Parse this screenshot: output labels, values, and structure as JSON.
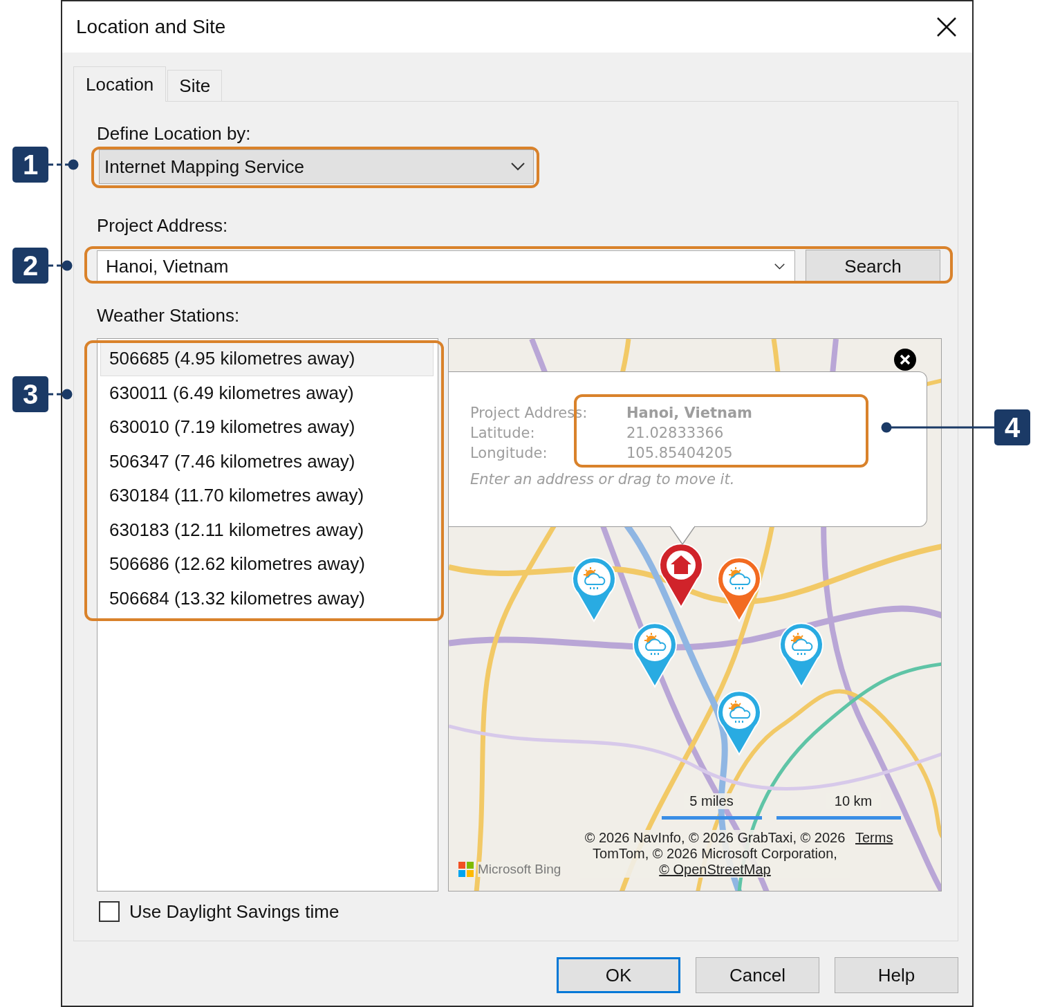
{
  "window": {
    "title": "Location and Site"
  },
  "tabs": [
    {
      "label": "Location",
      "selected": true
    },
    {
      "label": "Site",
      "selected": false
    }
  ],
  "define_location": {
    "label": "Define Location by:",
    "value": "Internet Mapping Service"
  },
  "project_address": {
    "label": "Project Address:",
    "value": "Hanoi, Vietnam",
    "button": "Search"
  },
  "weather_stations": {
    "label": "Weather Stations:",
    "items": [
      {
        "text": "506685 (4.95 kilometres away)",
        "selected": true
      },
      {
        "text": "630011 (6.49 kilometres away)",
        "selected": false
      },
      {
        "text": "630010 (7.19 kilometres away)",
        "selected": false
      },
      {
        "text": "506347 (7.46 kilometres away)",
        "selected": false
      },
      {
        "text": "630184 (11.70 kilometres away)",
        "selected": false
      },
      {
        "text": "630183 (12.11 kilometres away)",
        "selected": false
      },
      {
        "text": "506686 (12.62 kilometres away)",
        "selected": false
      },
      {
        "text": "506684 (13.32 kilometres away)",
        "selected": false
      }
    ]
  },
  "map": {
    "kind": "picture",
    "pins": [
      {
        "kind": "home",
        "color": "#d0232a"
      },
      {
        "kind": "weather",
        "color": "#29abe2"
      },
      {
        "kind": "weather",
        "color": "#f26b21"
      },
      {
        "kind": "weather",
        "color": "#29abe2"
      },
      {
        "kind": "weather",
        "color": "#29abe2"
      },
      {
        "kind": "weather",
        "color": "#29abe2"
      }
    ],
    "popup": {
      "rows": [
        {
          "label": "Project Address:",
          "value": "Hanoi, Vietnam",
          "bold": true
        },
        {
          "label": "Latitude:",
          "value": "21.02833366",
          "bold": false
        },
        {
          "label": "Longitude:",
          "value": "105.85404205",
          "bold": false
        }
      ],
      "hint": "Enter an address or drag to move it."
    },
    "scale": [
      "5 miles",
      "10 km"
    ],
    "attribution": {
      "text": "© 2026 NavInfo, © 2026 GrabTaxi, © 2026 TomTom, © 2026 Microsoft Corporation,",
      "link": "© OpenStreetMap"
    },
    "terms": "Terms",
    "logo": "Microsoft Bing"
  },
  "daylight_savings": {
    "label": "Use Daylight Savings time",
    "checked": false
  },
  "buttons": [
    {
      "label": "OK",
      "default": true
    },
    {
      "label": "Cancel",
      "default": false
    },
    {
      "label": "Help",
      "default": false
    }
  ],
  "callouts": [
    "1",
    "2",
    "3",
    "4"
  ]
}
